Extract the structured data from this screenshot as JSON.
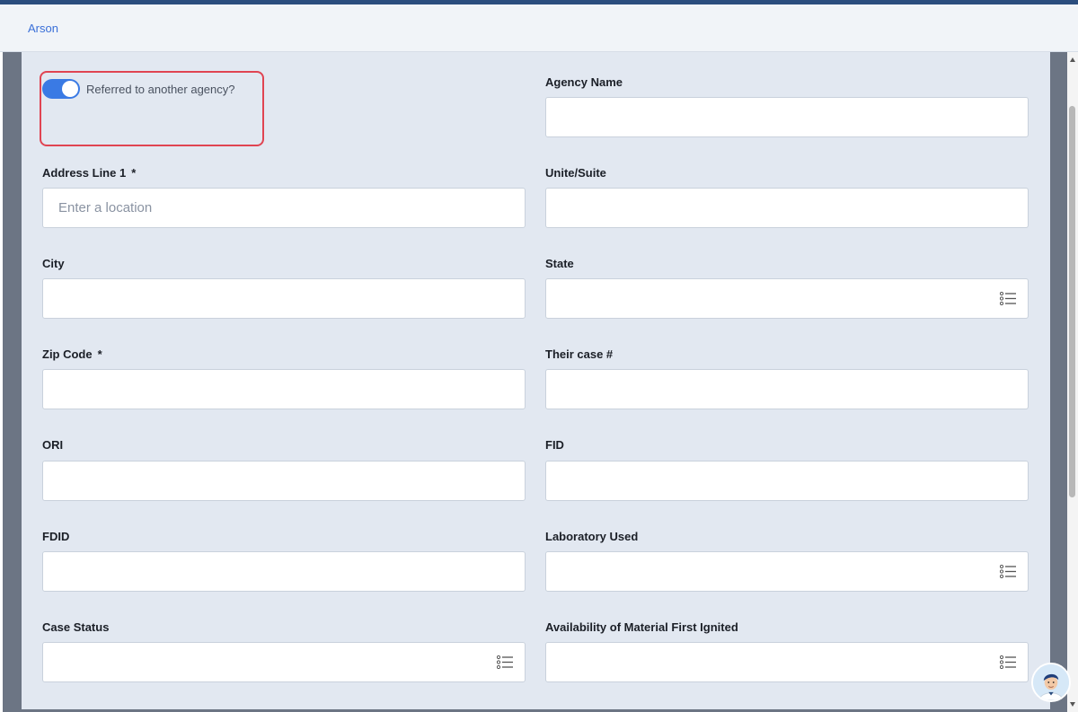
{
  "tabs": [
    {
      "label": "Arson",
      "active": true
    }
  ],
  "toggle": {
    "label": "Referred to another agency?",
    "on": true
  },
  "fields": [
    {
      "key": "agency_name",
      "label": "Agency Name",
      "required": false,
      "type": "text",
      "placeholder": "",
      "value": ""
    },
    {
      "key": "address_line_1",
      "label": "Address Line 1",
      "required": true,
      "type": "text",
      "placeholder": "Enter a location",
      "value": ""
    },
    {
      "key": "unit_suite",
      "label": "Unite/Suite",
      "required": false,
      "type": "text",
      "placeholder": "",
      "value": ""
    },
    {
      "key": "city",
      "label": "City",
      "required": false,
      "type": "text",
      "placeholder": "",
      "value": ""
    },
    {
      "key": "state",
      "label": "State",
      "required": false,
      "type": "select",
      "placeholder": "",
      "value": ""
    },
    {
      "key": "zip_code",
      "label": "Zip Code",
      "required": true,
      "type": "text",
      "placeholder": "",
      "value": ""
    },
    {
      "key": "their_case",
      "label": "Their case #",
      "required": false,
      "type": "text",
      "placeholder": "",
      "value": ""
    },
    {
      "key": "ori",
      "label": "ORI",
      "required": false,
      "type": "text",
      "placeholder": "",
      "value": ""
    },
    {
      "key": "fid",
      "label": "FID",
      "required": false,
      "type": "text",
      "placeholder": "",
      "value": ""
    },
    {
      "key": "fdid",
      "label": "FDID",
      "required": false,
      "type": "text",
      "placeholder": "",
      "value": ""
    },
    {
      "key": "laboratory_used",
      "label": "Laboratory Used",
      "required": false,
      "type": "select",
      "placeholder": "",
      "value": ""
    },
    {
      "key": "case_status",
      "label": "Case Status",
      "required": false,
      "type": "select",
      "placeholder": "",
      "value": ""
    },
    {
      "key": "availability_material",
      "label": "Availability of Material First Ignited",
      "required": false,
      "type": "select",
      "placeholder": "",
      "value": ""
    }
  ],
  "required_marker": "*",
  "icons": {
    "select_icon": "list-icon",
    "assistant": "assistant-avatar-icon"
  },
  "colors": {
    "accent": "#3a7ae4",
    "highlight": "#e04452",
    "panel_bg": "#e2e8f1",
    "frame": "#6c7584",
    "top_bar": "#2b4d7e"
  }
}
